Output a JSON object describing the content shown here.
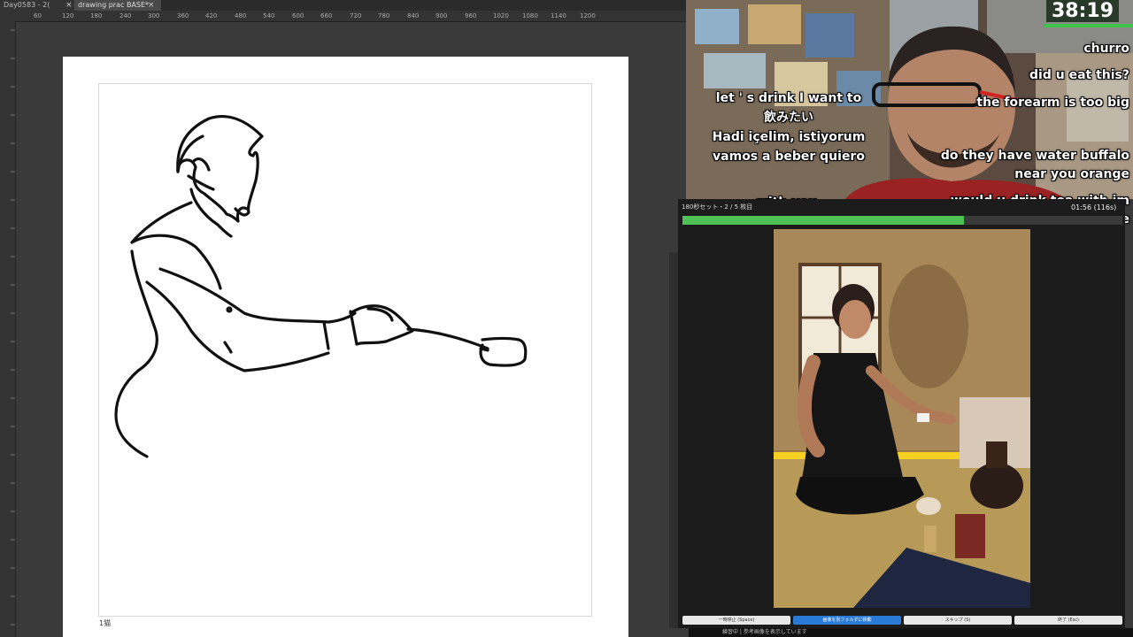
{
  "app": {
    "tabs": [
      {
        "label": "Day0583 - 2("
      },
      {
        "label": "drawing prac BASE*"
      }
    ],
    "ruler_labels": [
      "60",
      "120",
      "180",
      "240",
      "300",
      "360",
      "420",
      "480",
      "540",
      "600",
      "660",
      "720",
      "780",
      "840",
      "900",
      "960",
      "1020",
      "1080",
      "1140",
      "1200"
    ],
    "page_label": "1猫"
  },
  "stream": {
    "timer": "38:19",
    "captions_left": [
      "let ' s drink I want to",
      "飲みたい",
      "Hadi içelim, istiyorum",
      "vamos a beber quiero",
      "with you"
    ],
    "chat": [
      "churro",
      "did u eat this?",
      "the forearm is too big",
      "do they have water buffalo",
      "near you orange",
      "would u drink tea with im",
      "orange"
    ]
  },
  "viewer": {
    "header": "180秒セット・2 / 5 枚目",
    "time": "01:56 (116s)",
    "progress": 0.64,
    "buttons": [
      "一時停止 (Space)",
      "画像を別フォルダに移動",
      "スキップ (S)",
      "終了 (Esc)"
    ],
    "bottom_text": "練習中 | 参考画像を表示しています"
  },
  "colors": {
    "accent_green": "#4fc157",
    "primary_button": "#2a7ad8"
  }
}
